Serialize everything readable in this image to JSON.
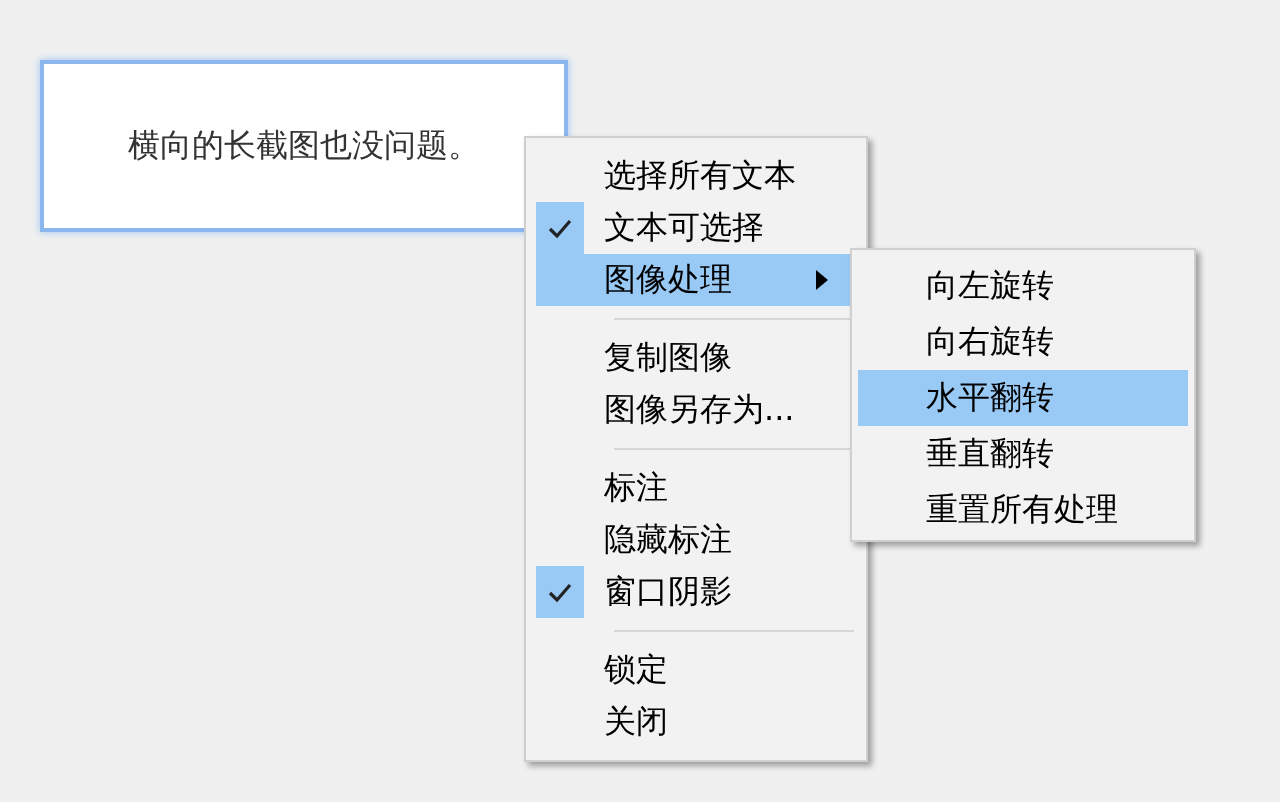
{
  "note": {
    "text": "横向的长截图也没问题。"
  },
  "menu": {
    "items": [
      {
        "kind": "item",
        "label": "选择所有文本",
        "checked": false,
        "selected": false,
        "submenu": false
      },
      {
        "kind": "item",
        "label": "文本可选择",
        "checked": true,
        "selected": false,
        "submenu": false
      },
      {
        "kind": "item",
        "label": "图像处理",
        "checked": false,
        "selected": true,
        "submenu": true
      },
      {
        "kind": "separator"
      },
      {
        "kind": "item",
        "label": "复制图像",
        "checked": false,
        "selected": false,
        "submenu": false
      },
      {
        "kind": "item",
        "label": "图像另存为...",
        "checked": false,
        "selected": false,
        "submenu": false
      },
      {
        "kind": "separator"
      },
      {
        "kind": "item",
        "label": "标注",
        "checked": false,
        "selected": false,
        "submenu": false
      },
      {
        "kind": "item",
        "label": "隐藏标注",
        "checked": false,
        "selected": false,
        "submenu": false
      },
      {
        "kind": "item",
        "label": "窗口阴影",
        "checked": true,
        "selected": false,
        "submenu": false
      },
      {
        "kind": "separator"
      },
      {
        "kind": "item",
        "label": "锁定",
        "checked": false,
        "selected": false,
        "submenu": false
      },
      {
        "kind": "item",
        "label": "关闭",
        "checked": false,
        "selected": false,
        "submenu": false
      }
    ]
  },
  "submenu": {
    "items": [
      {
        "label": "向左旋转",
        "selected": false
      },
      {
        "label": "向右旋转",
        "selected": false
      },
      {
        "label": "水平翻转",
        "selected": true
      },
      {
        "label": "垂直翻转",
        "selected": false
      },
      {
        "label": "重置所有处理",
        "selected": false
      }
    ]
  }
}
